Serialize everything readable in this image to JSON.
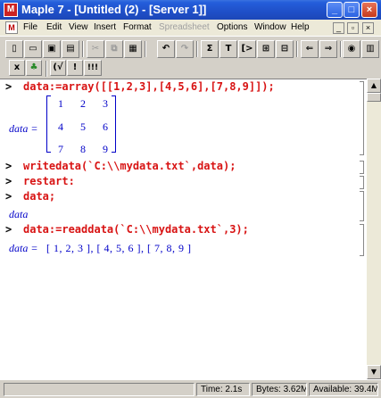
{
  "window": {
    "title": "Maple 7 - [Untitled (2) - [Server 1]]",
    "app_icon": "maple-leaf-icon"
  },
  "title_buttons": {
    "minimize": "_",
    "maximize": "□",
    "close": "×"
  },
  "menu": {
    "items": [
      {
        "label": "File",
        "disabled": false
      },
      {
        "label": "Edit",
        "disabled": false
      },
      {
        "label": "View",
        "disabled": false
      },
      {
        "label": "Insert",
        "disabled": false
      },
      {
        "label": "Format",
        "disabled": false
      },
      {
        "label": "Spreadsheet",
        "disabled": true
      },
      {
        "label": "Options",
        "disabled": false
      },
      {
        "label": "Window",
        "disabled": false
      },
      {
        "label": "Help",
        "disabled": false
      }
    ]
  },
  "toolbar_main": [
    {
      "icon": "new-file-icon",
      "glyph": "▯"
    },
    {
      "icon": "open-file-icon",
      "glyph": "▭"
    },
    {
      "icon": "save-icon",
      "glyph": "▣"
    },
    {
      "icon": "print-icon",
      "glyph": "▤"
    },
    {
      "icon": "cut-icon",
      "glyph": "✂"
    },
    {
      "icon": "copy-icon",
      "glyph": "⧉"
    },
    {
      "icon": "paste-icon",
      "glyph": "▦"
    },
    {
      "icon": "undo-icon",
      "glyph": "↶"
    },
    {
      "icon": "redo-icon",
      "glyph": "↷"
    },
    {
      "icon": "sum-icon",
      "glyph": "Σ"
    },
    {
      "icon": "text-icon",
      "glyph": "T"
    },
    {
      "icon": "input-icon",
      "glyph": "[>"
    },
    {
      "icon": "expand-section-icon",
      "glyph": "⊞"
    },
    {
      "icon": "collapse-section-icon",
      "glyph": "⊟"
    },
    {
      "icon": "back-icon",
      "glyph": "⇐"
    },
    {
      "icon": "forward-icon",
      "glyph": "⇒"
    },
    {
      "icon": "stop-icon",
      "glyph": "◉"
    },
    {
      "icon": "restart-icon",
      "glyph": "▥"
    }
  ],
  "toolbar_context": [
    {
      "icon": "math-mode-icon",
      "glyph": "x"
    },
    {
      "icon": "maple-input-icon",
      "glyph": "♣"
    },
    {
      "icon": "symbolic-icon",
      "glyph": "(√"
    },
    {
      "icon": "execute-icon",
      "glyph": "!"
    },
    {
      "icon": "execute-all-icon",
      "glyph": "!!!"
    }
  ],
  "worksheet": {
    "prompt": ">",
    "cmd1": "data:=array([[1,2,3],[4,5,6],[7,8,9]]);",
    "out1_label": "data =",
    "matrix": [
      [
        "1",
        "2",
        "3"
      ],
      [
        "4",
        "5",
        "6"
      ],
      [
        "7",
        "8",
        "9"
      ]
    ],
    "cmd2": "writedata(`C:\\\\mydata.txt`,data);",
    "cmd3": "restart:",
    "cmd4": "data;",
    "out4": "data",
    "cmd5": "data:=readdata(`C:\\\\mydata.txt`,3);",
    "out5_label": "data =",
    "out5_value": "[ 1, 2, 3 ], [ 4, 5, 6 ], [ 7, 8, 9 ]"
  },
  "status": {
    "time": "Time: 2.1s",
    "bytes": "Bytes: 3.62M",
    "available": "Available: 39.4M"
  }
}
